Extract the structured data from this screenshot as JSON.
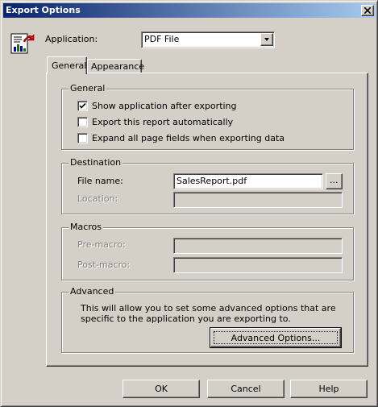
{
  "window": {
    "title": "Export Options"
  },
  "application": {
    "label": "Application:",
    "label_underline": "A",
    "selected": "PDF File",
    "icon": "export-report-icon"
  },
  "tabs": [
    {
      "label": "General",
      "active": true
    },
    {
      "label": "Appearance",
      "active": false
    }
  ],
  "general_group": {
    "title": "General",
    "options": [
      {
        "label": "Show application after exporting",
        "checked": true
      },
      {
        "label": "Export this report automatically",
        "checked": false
      },
      {
        "label": "Expand all page fields when exporting data",
        "checked": false
      }
    ]
  },
  "destination_group": {
    "title": "Destination",
    "file_name_label": "File name:",
    "file_name_value": "SalesReport.pdf",
    "browse_label": "...",
    "location_label": "Location:",
    "location_value": ""
  },
  "macros_group": {
    "title": "Macros",
    "pre_macro_label": "Pre-macro:",
    "pre_macro_value": "",
    "post_macro_label": "Post-macro:",
    "post_macro_value": ""
  },
  "advanced_group": {
    "title": "Advanced",
    "description": "This will allow you to set some advanced options that are specific to the application you are exporting to.",
    "button_label": "Advanced Options..."
  },
  "buttons": {
    "ok": "OK",
    "cancel": "Cancel",
    "help": "Help"
  },
  "colors": {
    "titlebar_start": "#0a246a",
    "titlebar_end": "#a6caf0",
    "face": "#d4d0c8"
  }
}
